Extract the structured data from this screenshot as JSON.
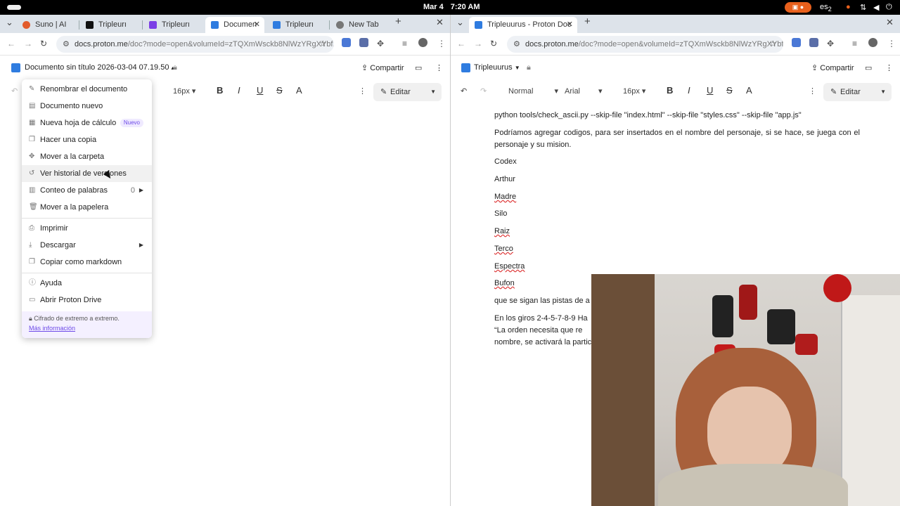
{
  "system": {
    "date": "Mar 4",
    "time": "7:20 AM",
    "keyboard": "es",
    "keyboard_sub": "2",
    "icons": [
      "activities-icon",
      "notification-icon",
      "mic-icon",
      "network-icon",
      "volume-icon",
      "power-icon"
    ]
  },
  "left_window": {
    "tabs": [
      {
        "label": "Suno | AI",
        "fav_color": "#e25b2b"
      },
      {
        "label": "Tripleurı",
        "fav_color": "#111111"
      },
      {
        "label": "Tripleurı",
        "fav_color": "#7b3ee6"
      },
      {
        "label": "Documen",
        "fav_color": "#2f7ce0"
      },
      {
        "label": "Tripleurı",
        "fav_color": "#2f7ce0"
      },
      {
        "label": "New Tab",
        "fav_color": "#777777"
      }
    ],
    "url_host": "docs.proton.me",
    "url_path": "/doc?mode=open&volumeId=zTQXmWsckb8NlWzYRgXYbf...",
    "doc_title": "Documento sin título 2026-03-04 07.19.50",
    "share": "Compartir",
    "font_size": "16px",
    "edit": "Editar",
    "menu": {
      "items": [
        {
          "label": "Renombrar el documento",
          "icon": "pencil-icon"
        },
        {
          "label": "Documento nuevo",
          "icon": "doc-icon"
        },
        {
          "label": "Nueva hoja de cálculo",
          "icon": "sheet-icon",
          "badge": "Nuevo"
        },
        {
          "label": "Hacer una copia",
          "icon": "copy-icon"
        },
        {
          "label": "Mover a la carpeta",
          "icon": "move-icon"
        },
        {
          "label": "Ver historial de versiones",
          "icon": "history-icon"
        },
        {
          "label": "Conteo de palabras",
          "icon": "count-icon",
          "count": "0"
        },
        {
          "label": "Mover a la papelera",
          "icon": "trash-icon"
        },
        {
          "label": "Imprimir",
          "icon": "print-icon"
        },
        {
          "label": "Descargar",
          "icon": "download-icon"
        },
        {
          "label": "Copiar como markdown",
          "icon": "markdown-icon"
        },
        {
          "label": "Ayuda",
          "icon": "help-icon"
        },
        {
          "label": "Abrir Proton Drive",
          "icon": "drive-icon"
        }
      ],
      "footer_text": "Cifrado de extremo a extremo.",
      "footer_link": "Más información"
    }
  },
  "right_window": {
    "tab_label": "Tripleuurus - Proton Doc",
    "url_host": "docs.proton.me",
    "url_path": "/doc?mode=open&volumeId=zTQXmWsckb8NlWzYRgXYbf...",
    "doc_title": "Tripleuurus",
    "share": "Compartir",
    "style": "Normal",
    "font": "Arial",
    "font_size": "16px",
    "edit": "Editar",
    "content": {
      "line1": "python tools/check_ascii.py --skip-file \"index.html\" --skip-file \"styles.css\" --skip-file \"app.js\"",
      "para2": "Podríamos agregar codigos, para ser insertados en el nombre del personaje, si se hace, se juega con el personaje y su mision.",
      "list": [
        "Codex",
        "Arthur",
        "Madre",
        "Silo",
        "Raiz",
        "Terco",
        "Espectra",
        "Bufon"
      ],
      "para3": "que se sigan las pistas de a",
      "para4_l1": "En los giros 2-4-5-7-8-9 Ha",
      "para4_l2": "“La orden necesita que re",
      "para4_l3": "nombre, se activará la partic"
    }
  },
  "colors": {
    "accent": "#6d4ae8",
    "proton_blue": "#2f7ce0",
    "spell_red": "#dd3333"
  }
}
